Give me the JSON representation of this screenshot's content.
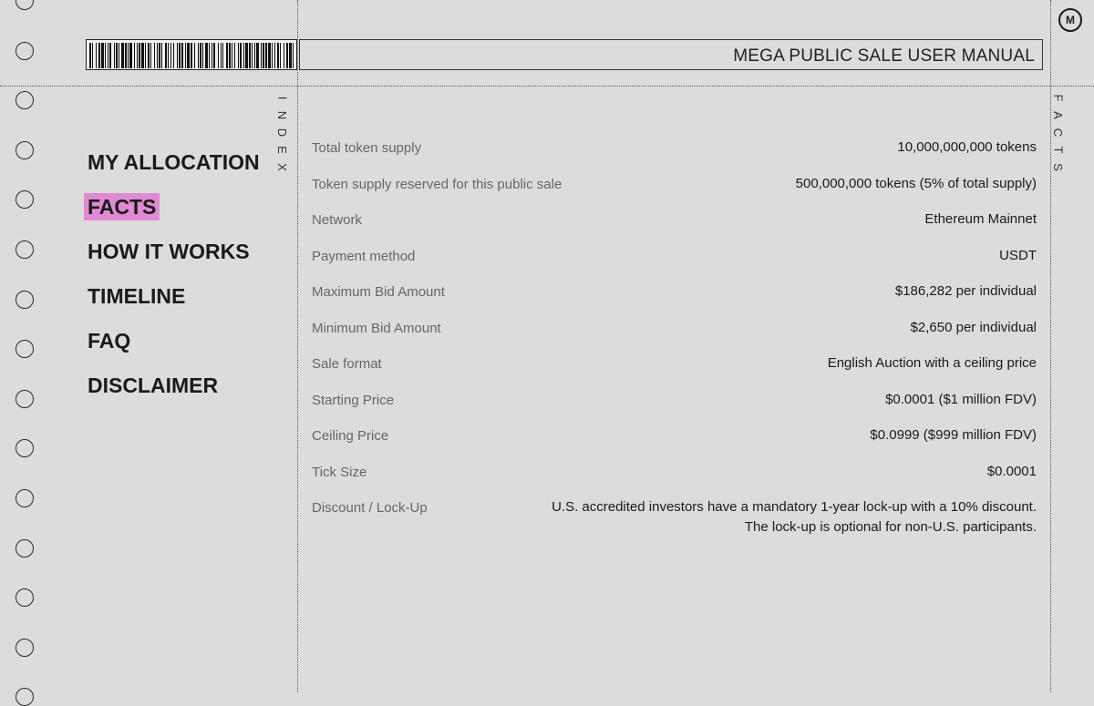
{
  "header": {
    "title": "MEGA PUBLIC SALE USER MANUAL"
  },
  "logo": {
    "icon": "m-logo-icon",
    "text": "M"
  },
  "index_label": [
    "I",
    "N",
    "D",
    "E",
    "X"
  ],
  "facts_label": [
    "F",
    "A",
    "C",
    "T",
    "S"
  ],
  "nav": {
    "items": [
      {
        "label": "MY ALLOCATION",
        "active": false
      },
      {
        "label": "FACTS",
        "active": true
      },
      {
        "label": "HOW IT WORKS",
        "active": false
      },
      {
        "label": "TIMELINE",
        "active": false
      },
      {
        "label": "FAQ",
        "active": false
      },
      {
        "label": "DISCLAIMER",
        "active": false
      }
    ]
  },
  "facts": [
    {
      "label": "Total token supply",
      "value": [
        "10,000,000,000 tokens"
      ]
    },
    {
      "label": "Token supply reserved for this public sale",
      "value": [
        "500,000,000 tokens (5% of total supply)"
      ]
    },
    {
      "label": "Network",
      "value": [
        "Ethereum Mainnet"
      ]
    },
    {
      "label": "Payment method",
      "value": [
        "USDT"
      ]
    },
    {
      "label": "Maximum Bid Amount",
      "value": [
        "$186,282 per individual"
      ]
    },
    {
      "label": "Minimum Bid Amount",
      "value": [
        "$2,650 per individual"
      ]
    },
    {
      "label": "Sale format",
      "value": [
        "English Auction with a ceiling price"
      ]
    },
    {
      "label": "Starting Price",
      "value": [
        "$0.0001 ($1 million FDV)"
      ]
    },
    {
      "label": "Ceiling Price",
      "value": [
        "$0.0999 ($999 million FDV)"
      ]
    },
    {
      "label": "Tick Size",
      "value": [
        "$0.0001"
      ]
    },
    {
      "label": "Discount / Lock-Up",
      "value": [
        "U.S. accredited investors have a mandatory 1-year lock-up with a 10% discount.",
        "The lock-up is optional for non-U.S. participants."
      ]
    }
  ],
  "colors": {
    "background": "#dedbdb",
    "highlight": "#e08ad4",
    "text": "#1a1a1a",
    "muted": "#666666"
  }
}
